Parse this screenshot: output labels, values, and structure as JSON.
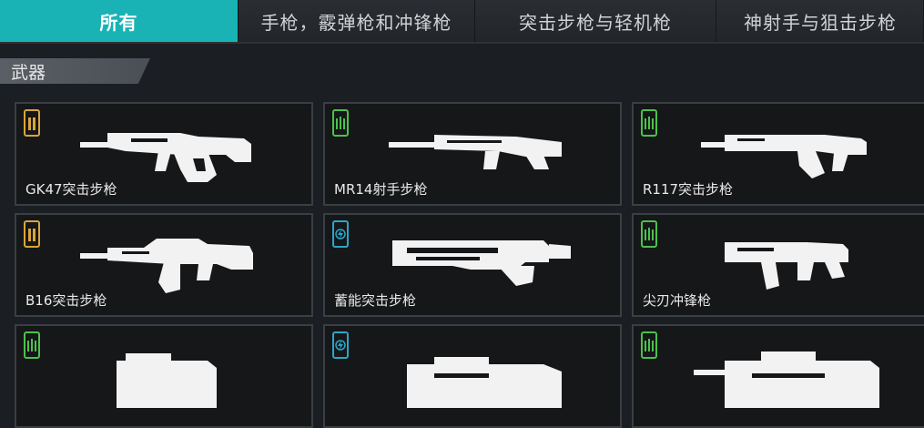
{
  "tabs": [
    {
      "label": "所有",
      "active": true
    },
    {
      "label": "手枪，霰弹枪和冲锋枪",
      "active": false
    },
    {
      "label": "突击步枪与轻机枪",
      "active": false
    },
    {
      "label": "神射手与狙击步枪",
      "active": false
    }
  ],
  "section": {
    "label": "武器"
  },
  "ammo_colors": {
    "heavy": "#d9a53a",
    "light": "#4bc24b",
    "energy": "#2aa6c8"
  },
  "weapons": [
    {
      "name": "GK47突击步枪",
      "ammo": "heavy",
      "icon": "assault-rifle-icon"
    },
    {
      "name": "MR14射手步枪",
      "ammo": "light",
      "icon": "marksman-rifle-icon"
    },
    {
      "name": "R117突击步枪",
      "ammo": "light",
      "icon": "assault-rifle-icon"
    },
    {
      "name": "B16突击步枪",
      "ammo": "heavy",
      "icon": "assault-rifle-icon"
    },
    {
      "name": "蓄能突击步枪",
      "ammo": "energy",
      "icon": "energy-rifle-icon"
    },
    {
      "name": "尖刃冲锋枪",
      "ammo": "light",
      "icon": "smg-icon"
    },
    {
      "name": "",
      "ammo": "light",
      "icon": "smg-icon"
    },
    {
      "name": "",
      "ammo": "energy",
      "icon": "energy-smg-icon"
    },
    {
      "name": "",
      "ammo": "light",
      "icon": "light-machine-gun-icon"
    }
  ]
}
